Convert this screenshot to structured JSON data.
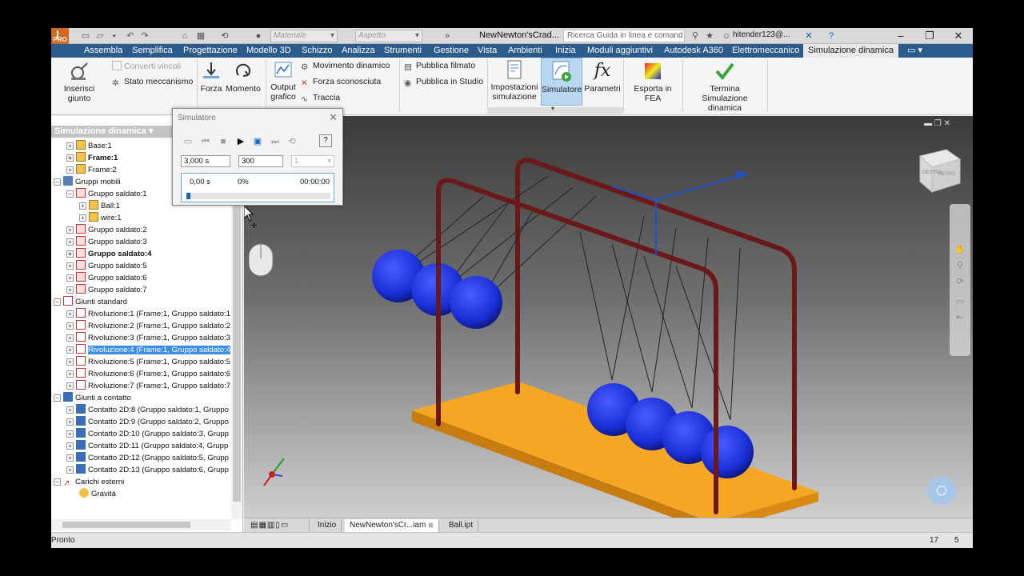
{
  "title_bar": {
    "material_placeholder": "Materiale",
    "appearance_placeholder": "Aspetto",
    "document_title": "NewNewton'sCrad...",
    "help_search_placeholder": "Ricerca Guida in linea e comand",
    "user": "hitender123@...",
    "logo_text": "PRO"
  },
  "tabs": [
    {
      "label": "Assembla"
    },
    {
      "label": "Semplifica"
    },
    {
      "label": "Progettazione"
    },
    {
      "label": "Modello 3D"
    },
    {
      "label": "Schizzo"
    },
    {
      "label": "Analizza"
    },
    {
      "label": "Strumenti"
    },
    {
      "label": "Gestione"
    },
    {
      "label": "Vista"
    },
    {
      "label": "Ambienti"
    },
    {
      "label": "Inizia"
    },
    {
      "label": "Moduli aggiuntivi"
    },
    {
      "label": "Autodesk A360"
    },
    {
      "label": "Elettromeccanico"
    },
    {
      "label": "Simulazione dinamica"
    }
  ],
  "ribbon": {
    "insert_joint": "Inserisci giunto",
    "convert_constraints": "Converti vincoli",
    "mechanism_status": "Stato meccanismo",
    "force": "Forza",
    "moment": "Momento",
    "output_graph_1": "Output",
    "output_graph_2": "grafico",
    "dynamic_motion": "Movimento dinamico",
    "unknown_force": "Forza sconosciuta",
    "trace": "Traccia",
    "publish_movie": "Pubblica filmato",
    "publish_studio": "Pubblica in Studio",
    "sim_settings_1": "Impostazioni",
    "sim_settings_2": "simulazione",
    "simulator": "Simulatore",
    "parameters": "Parametri",
    "export_fea": "Esporta in FEA",
    "finish_1": "Termina",
    "finish_2": "Simulazione dinamica"
  },
  "browser": {
    "header": "Simulazione dinamica ▾",
    "nodes": [
      {
        "label": "Base:1"
      },
      {
        "label": "Frame:1"
      },
      {
        "label": "Frame:2"
      },
      {
        "label": "Gruppi mobili"
      },
      {
        "label": "Gruppo saldato:1"
      },
      {
        "label": "Ball:1"
      },
      {
        "label": "wire:1"
      },
      {
        "label": "Gruppo saldato:2"
      },
      {
        "label": "Gruppo saldato:3"
      },
      {
        "label": "Gruppo saldato:4"
      },
      {
        "label": "Gruppo saldato:5"
      },
      {
        "label": "Gruppo saldato:6"
      },
      {
        "label": "Gruppo saldato:7"
      },
      {
        "label": "Giunti standard"
      },
      {
        "label": "Rivoluzione:1 (Frame:1, Gruppo saldato:1"
      },
      {
        "label": "Rivoluzione:2 (Frame:1, Gruppo saldato:2"
      },
      {
        "label": "Rivoluzione:3 (Frame:1, Gruppo saldato:3"
      },
      {
        "label": "Rivoluzione:4 (Frame:1, Gruppo saldato:4"
      },
      {
        "label": "Rivoluzione:5 (Frame:1, Gruppo saldato:5"
      },
      {
        "label": "Rivoluzione:6 (Frame:1, Gruppo saldato:6"
      },
      {
        "label": "Rivoluzione:7 (Frame:1, Gruppo saldato:7"
      },
      {
        "label": "Giunti a contatto"
      },
      {
        "label": "Contatto 2D:8 (Gruppo saldato:1, Gruppo"
      },
      {
        "label": "Contatto 2D:9 (Gruppo saldato:2, Gruppo"
      },
      {
        "label": "Contatto 2D:10 (Gruppo saldato:3, Grupp"
      },
      {
        "label": "Contatto 2D:11 (Gruppo saldato:4, Grupp"
      },
      {
        "label": "Contatto 2D:12 (Gruppo saldato:5, Grupp"
      },
      {
        "label": "Contatto 2D:13 (Gruppo saldato:6, Grupp"
      },
      {
        "label": "Carichi esterni"
      },
      {
        "label": "Gravità"
      }
    ]
  },
  "simulator": {
    "title": "Simulatore",
    "end_time": "3,000 s",
    "images": "300",
    "filter": "1",
    "current_time": "0,00 s",
    "percent": "0%",
    "elapsed": "00:00:00",
    "progress_fraction": 0.03
  },
  "viewport_tabs": {
    "home": "Inizio",
    "assembly": "NewNewton'sCr...iam",
    "part": "Ball.ipt"
  },
  "viewcube": {
    "face": "DESTRA",
    "face2": "RETRO"
  },
  "status": {
    "text": "Pronto",
    "count1": "17",
    "count2": "5"
  },
  "colors": {
    "ribbon_tab_bg": "#2b5b8a",
    "ball": "#1a2fd6",
    "frame": "#6b1818",
    "base": "#f0a020",
    "selection": "#3a8ee6"
  }
}
